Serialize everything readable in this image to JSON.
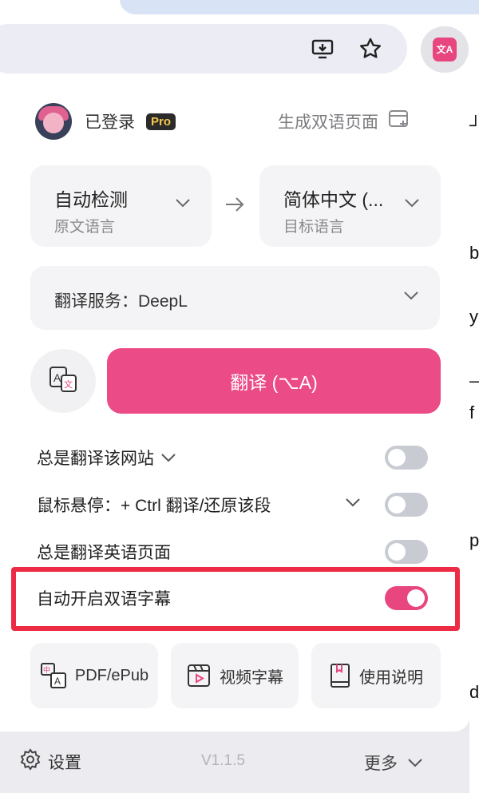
{
  "header": {
    "user_status": "已登录",
    "pro_badge": "Pro",
    "generate_bilingual": "生成双语页面"
  },
  "languages": {
    "source_main": "自动检测",
    "source_sub": "原文语言",
    "target_main": "简体中文 (...",
    "target_sub": "目标语言"
  },
  "service": {
    "label": "翻译服务：DeepL"
  },
  "translate_button": "翻译 (⌥A)",
  "options": [
    {
      "label": "总是翻译该网站",
      "enabled": false
    },
    {
      "label": "鼠标悬停：+ Ctrl 翻译/还原该段",
      "enabled": false
    },
    {
      "label": "总是翻译英语页面",
      "enabled": false
    },
    {
      "label": "自动开启双语字幕",
      "enabled": true
    }
  ],
  "tools": {
    "pdf": "PDF/ePub",
    "video": "视频字幕",
    "manual": "使用说明"
  },
  "footer": {
    "settings": "设置",
    "version": "V1.1.5",
    "more": "更多"
  },
  "extension_icon_text": "文A",
  "colors": {
    "accent": "#eb4b86",
    "highlight_border": "#ee2b44",
    "toggle_off": "#c8ccd2"
  }
}
